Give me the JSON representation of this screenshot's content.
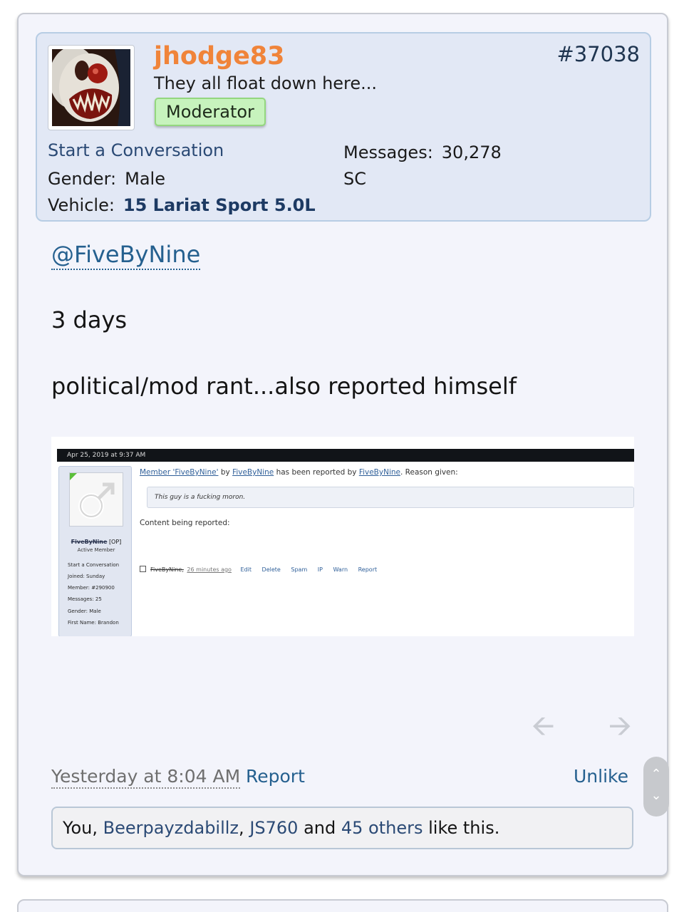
{
  "post": {
    "username": "jhodge83",
    "post_number": "#37038",
    "user_title": "They all float down here...",
    "badge": "Moderator",
    "start_conversation": "Start a Conversation",
    "gender_label": "Gender:",
    "gender_value": "Male",
    "vehicle_label": "Vehicle:",
    "vehicle_value": "15 Lariat Sport 5.0L",
    "messages_label": "Messages:",
    "messages_value": "30,278",
    "location": "SC",
    "mention": "@FiveByNine",
    "body_line_1": "3 days",
    "body_line_2": "political/mod rant...also reported himself",
    "timestamp": "Yesterday at 8:04 AM",
    "report_label": "Report",
    "unlike_label": "Unlike"
  },
  "embed": {
    "date": "Apr 25, 2019 at 9:37 AM",
    "report_member_link": "Member 'FiveByNine'",
    "report_by": "by",
    "report_user_link": "FiveByNine",
    "report_reported_by": "has been reported by",
    "report_reporter_link": "FiveByNine",
    "report_reason_suffix": ". Reason given:",
    "reason": "This guy is a fucking moron.",
    "content_label": "Content being reported:",
    "sidebar": {
      "name": "FiveByNine",
      "op": "[OP]",
      "role": "Active Member",
      "start_conversation": "Start a Conversation",
      "joined": "Joined: Sunday",
      "member": "Member: #290900",
      "messages": "Messages: 25",
      "gender": "Gender: Male",
      "first_name": "First Name: Brandon"
    },
    "mod_row": {
      "author": "FiveByNine,",
      "time": "26 minutes ago",
      "actions": [
        "Edit",
        "Delete",
        "Spam",
        "IP",
        "Warn",
        "Report"
      ]
    }
  },
  "likes": {
    "prefix": "You,",
    "user1": "Beerpayzdabillz",
    "sep": ",",
    "user2": "JS760",
    "and": "and",
    "others": "45 others",
    "suffix": "like this."
  },
  "icons": {
    "prev": "arrow-left-icon",
    "next": "arrow-right-icon",
    "scroll_up": "chevron-up-icon",
    "scroll_down": "chevron-down-icon"
  },
  "colors": {
    "username": "#f0843a",
    "link": "#25608f",
    "badge_bg": "#c7f3bd"
  }
}
